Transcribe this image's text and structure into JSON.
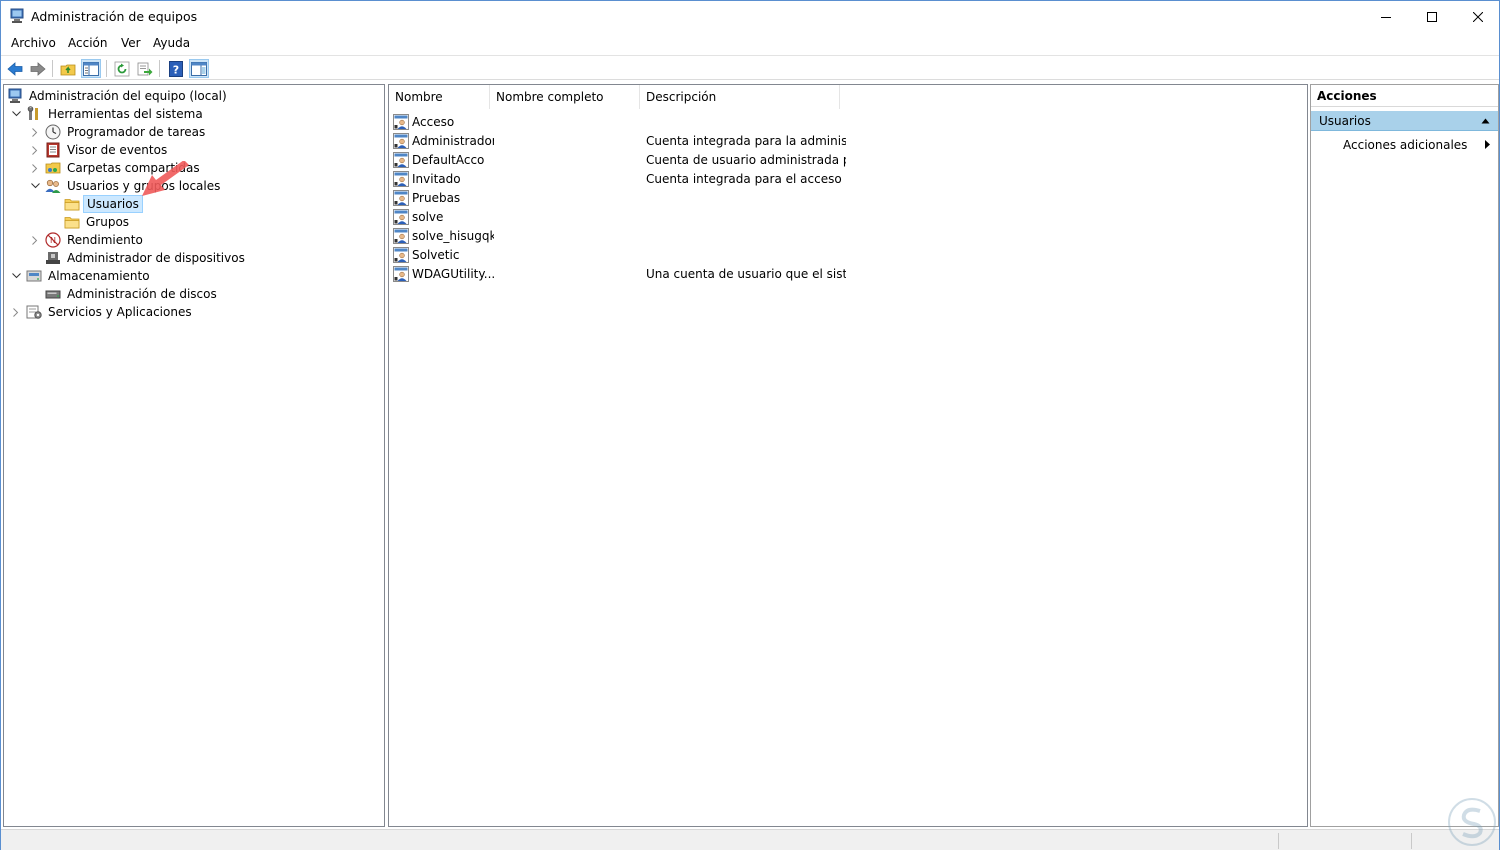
{
  "window": {
    "title": "Administración de equipos"
  },
  "menu": [
    "Archivo",
    "Acción",
    "Ver",
    "Ayuda"
  ],
  "tree": [
    {
      "label": "Administración del equipo (local)",
      "icon": "computer-management-icon"
    },
    {
      "label": "Herramientas del sistema",
      "icon": "tools-icon"
    },
    {
      "label": "Programador de tareas",
      "icon": "clock-icon"
    },
    {
      "label": "Visor de eventos",
      "icon": "event-viewer-icon"
    },
    {
      "label": "Carpetas compartidas",
      "icon": "shared-folder-icon"
    },
    {
      "label": "Usuarios y grupos locales",
      "icon": "users-groups-icon"
    },
    {
      "label": "Usuarios",
      "icon": "folder-icon"
    },
    {
      "label": "Grupos",
      "icon": "folder-icon"
    },
    {
      "label": "Rendimiento",
      "icon": "performance-icon"
    },
    {
      "label": "Administrador de dispositivos",
      "icon": "device-manager-icon"
    },
    {
      "label": "Almacenamiento",
      "icon": "storage-icon"
    },
    {
      "label": "Administración de discos",
      "icon": "disk-icon"
    },
    {
      "label": "Servicios y Aplicaciones",
      "icon": "services-icon"
    }
  ],
  "list": {
    "columns": [
      "Nombre",
      "Nombre completo",
      "Descripción"
    ],
    "rows": [
      {
        "name": "Acceso",
        "full_name": "",
        "description": ""
      },
      {
        "name": "Administrador",
        "full_name": "",
        "description": "Cuenta integrada para la administ..."
      },
      {
        "name": "DefaultAcco",
        "full_name": "",
        "description": "Cuenta de usuario administrada p..."
      },
      {
        "name": "Invitado",
        "full_name": "",
        "description": "Cuenta integrada para el acceso c..."
      },
      {
        "name": "Pruebas",
        "full_name": "",
        "description": ""
      },
      {
        "name": "solve",
        "full_name": "",
        "description": ""
      },
      {
        "name": "solve_hisugqk",
        "full_name": "",
        "description": ""
      },
      {
        "name": "Solvetic",
        "full_name": "",
        "description": ""
      },
      {
        "name": "WDAGUtility...",
        "full_name": "",
        "description": "Una cuenta de usuario que el siste..."
      }
    ]
  },
  "actions": {
    "title": "Acciones",
    "section": "Usuarios",
    "more": "Acciones adicionales"
  },
  "colors": {
    "selection": "#cce8ff",
    "action_section": "#a9d1ea",
    "annotation_arrow": "#f05a5a"
  }
}
